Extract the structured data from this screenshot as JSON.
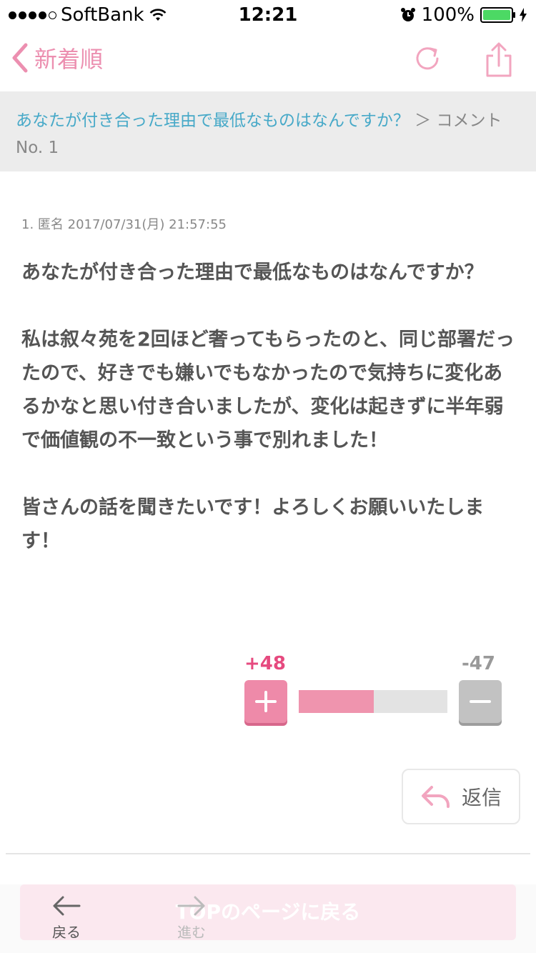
{
  "status_bar": {
    "carrier": "SoftBank",
    "time": "12:21",
    "battery": "100%"
  },
  "nav": {
    "back_label": "新着順"
  },
  "breadcrumb": {
    "topic": "あなたが付き合った理由で最低なものはなんですか？",
    "separator": "＞",
    "rest": "コメント No. 1"
  },
  "post": {
    "meta": "1. 匿名 2017/07/31(月) 21:57:55",
    "paragraphs": [
      "あなたが付き合った理由で最低なものはなんですか？",
      "私は叙々苑を2回ほど奢ってもらったのと、同じ部署だったので、好きでも嫌いでもなかったので気持ちに変化あるかなと思い付き合いましたが、変化は起きずに半年弱で価値観の不一致という事で別れました！",
      "皆さんの話を聞きたいです！よろしくお願いいたします！"
    ],
    "plus_count": "+48",
    "minus_count": "-47",
    "plus_ratio": 0.505,
    "reply_label": "返信"
  },
  "bottom": {
    "top_page_label": "TOPのページに戻る",
    "back_label": "戻る",
    "forward_label": "進む"
  },
  "colors": {
    "accent_pink": "#ec8fb0",
    "link_blue": "#47a9c8",
    "plus_pink": "#e64a7f"
  }
}
